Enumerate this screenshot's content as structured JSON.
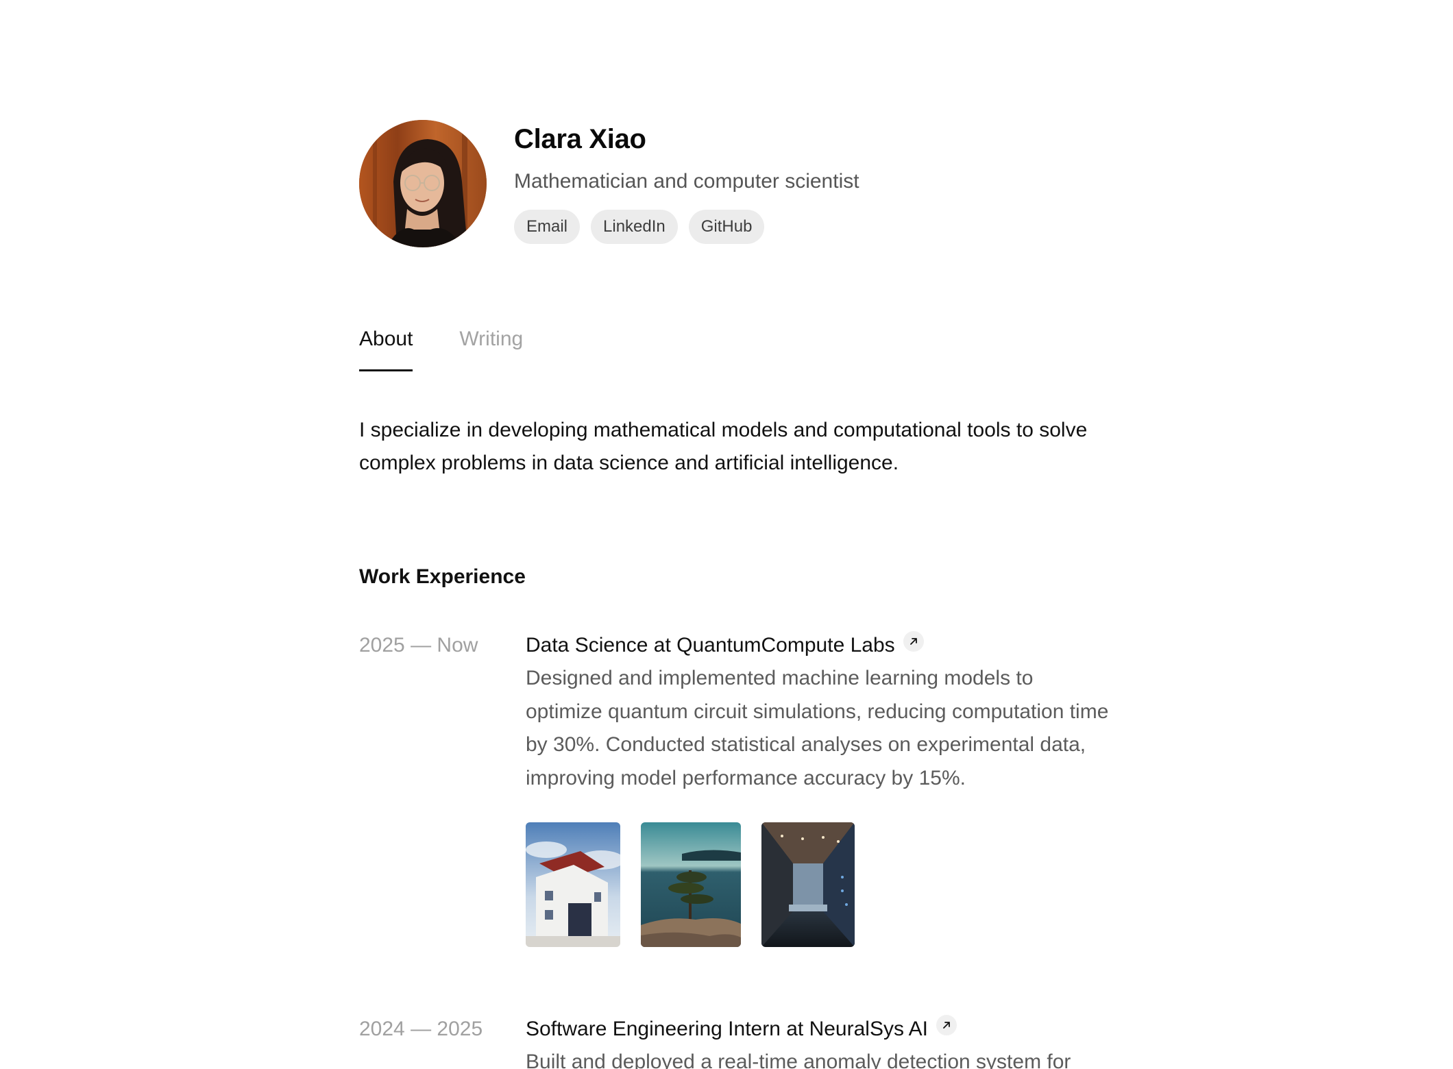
{
  "profile": {
    "name": "Clara Xiao",
    "tagline": "Mathematician and computer scientist",
    "links": [
      "Email",
      "LinkedIn",
      "GitHub"
    ]
  },
  "tabs": [
    {
      "label": "About",
      "active": true
    },
    {
      "label": "Writing",
      "active": false
    }
  ],
  "about": {
    "text": "I specialize in developing mathematical models and computational tools to solve complex problems in data science and artificial intelligence."
  },
  "work": {
    "title": "Work Experience",
    "jobs": [
      {
        "period": "2025 — Now",
        "title": "Data Science at QuantumCompute Labs",
        "description": "Designed and implemented machine learning models to optimize quantum circuit simulations, reducing computation time by 30%. Conducted statistical analyses on experimental data, improving model performance accuracy by 15%."
      },
      {
        "period": "2024 — 2025",
        "title": "Software Engineering Intern at NeuralSys AI",
        "description": "Built and deployed a real-time anomaly detection system for"
      }
    ]
  },
  "icons": {
    "external_link": "arrow-up-right-icon"
  },
  "colors": {
    "text": "#111111",
    "muted": "#a0a0a0",
    "body_gray": "#5b5b5b",
    "pill_bg": "#ececec"
  }
}
